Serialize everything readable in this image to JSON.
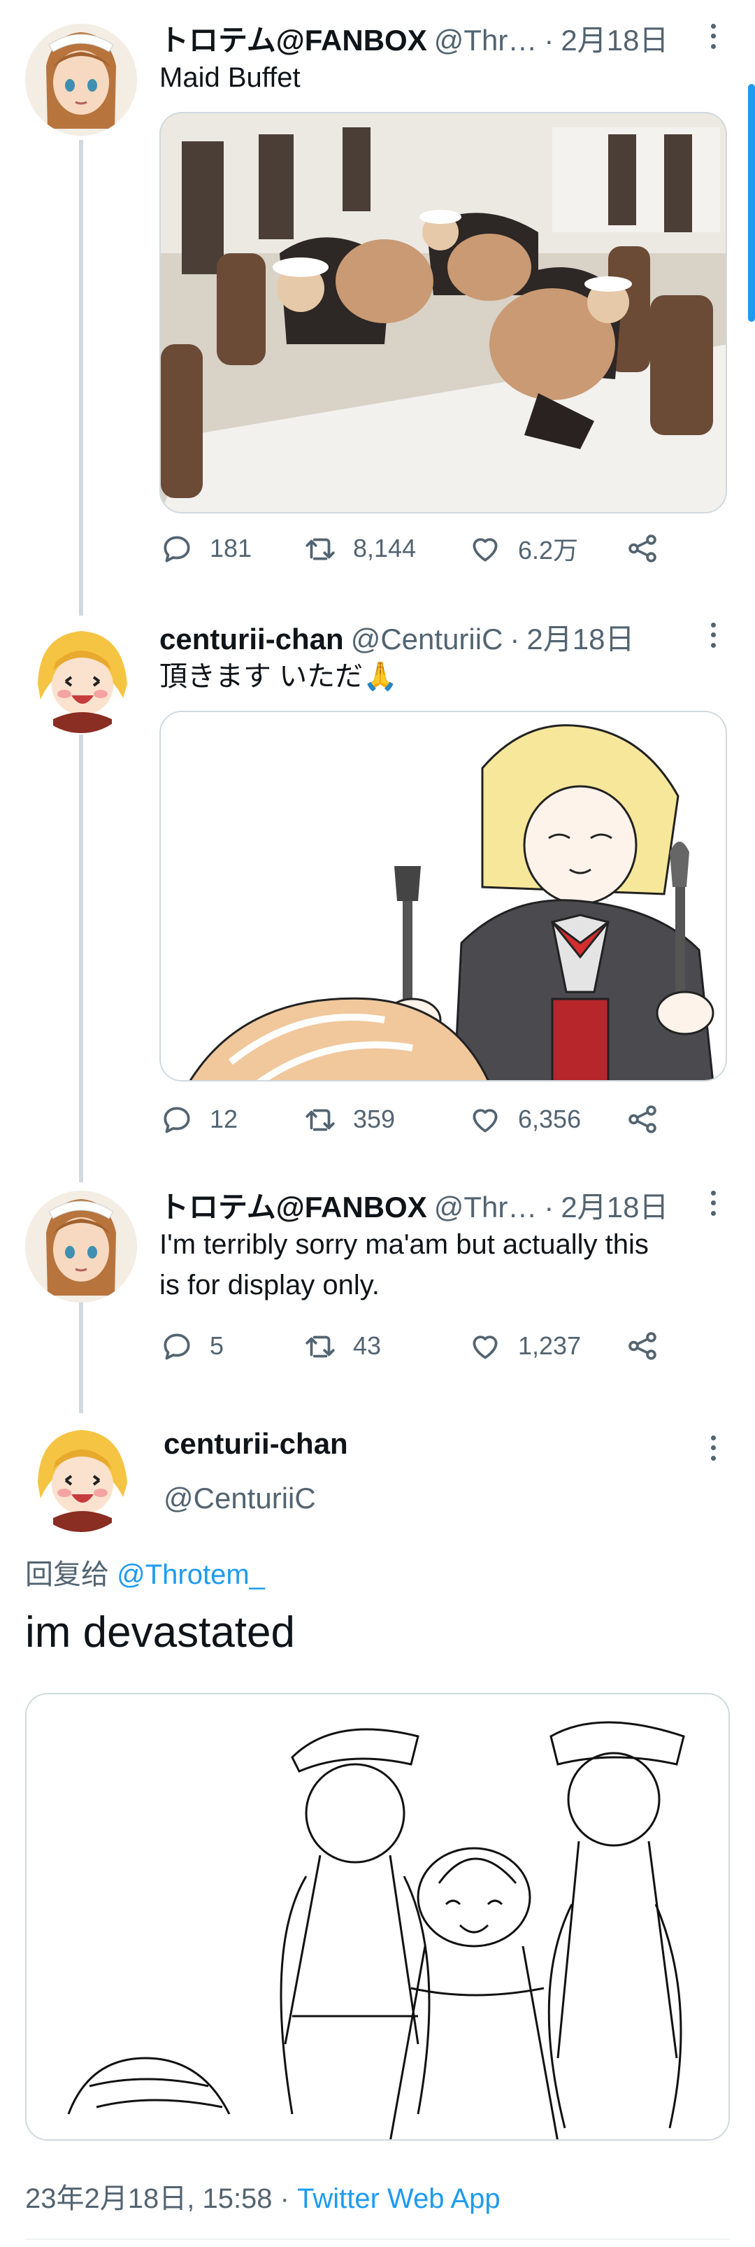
{
  "tweets": [
    {
      "display_name": "トロテム@FANBOX",
      "handle": "@Thr…",
      "date": "2月18日",
      "text": "Maid Buffet",
      "replies": "181",
      "retweets": "8,144",
      "likes": "6.2万"
    },
    {
      "display_name": "centurii-chan",
      "handle": "@CenturiiC",
      "date": "2月18日",
      "text": "頂きます いただ🙏",
      "replies": "12",
      "retweets": "359",
      "likes": "6,356"
    },
    {
      "display_name": "トロテム@FANBOX",
      "handle": "@Thr…",
      "date": "2月18日",
      "text_line1": "I'm terribly sorry ma'am but actually this",
      "text_line2": "is for display only.",
      "replies": "5",
      "retweets": "43",
      "likes": "1,237"
    }
  ],
  "focused": {
    "display_name": "centurii-chan",
    "handle": "@CenturiiC",
    "reply_prefix": "回复给",
    "reply_to": "@Throtem_",
    "text": "im devastated",
    "timestamp": "23年2月18日, 15:58 ·",
    "source": "Twitter Web App"
  },
  "separator": "·",
  "icons": {
    "reply": "reply-icon",
    "retweet": "retweet-icon",
    "like": "heart-icon",
    "share": "share-icon",
    "more": "more-vertical-icon"
  },
  "colors": {
    "text": "#0f1419",
    "secondary": "#536471",
    "accent": "#1d9bf0",
    "border": "#cfd9de"
  }
}
